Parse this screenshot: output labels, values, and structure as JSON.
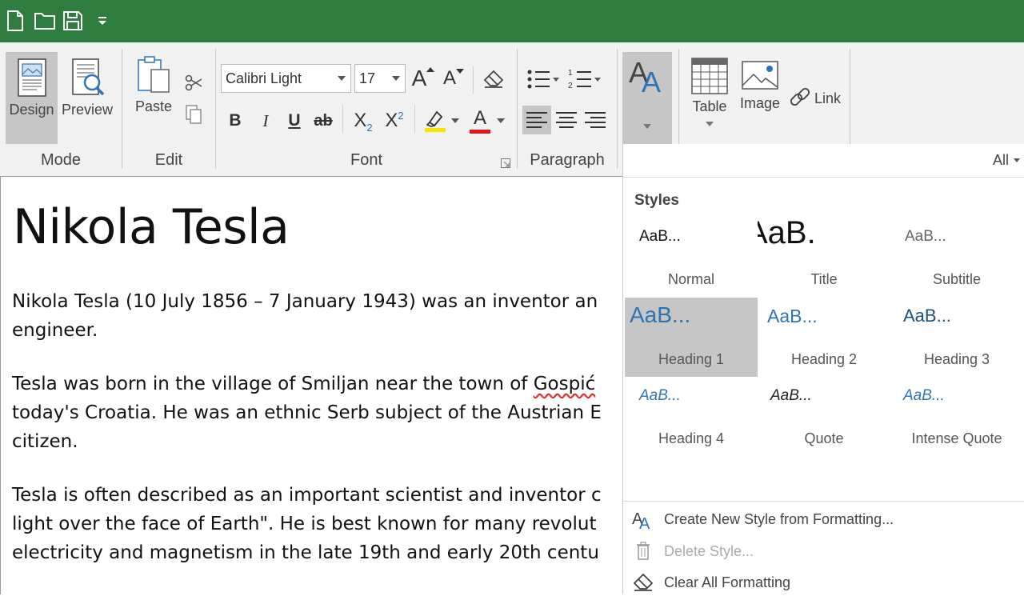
{
  "quick_access": {
    "icons": [
      "new-document-icon",
      "open-folder-icon",
      "save-icon",
      "customize-dropdown-icon"
    ]
  },
  "ribbon": {
    "mode": {
      "label": "Mode",
      "design": "Design",
      "preview": "Preview"
    },
    "edit": {
      "label": "Edit",
      "paste": "Paste"
    },
    "font": {
      "label": "Font",
      "family": "Calibri Light",
      "size": "17",
      "bold": "B",
      "italic": "I",
      "underline": "U",
      "strike": "ab",
      "subscript_base": "X",
      "subscript": "2",
      "superscript_base": "X",
      "superscript": "2",
      "grow": "A",
      "shrink": "A",
      "font_color_letter": "A",
      "font_color": "#e0161b",
      "highlight_color": "#f5e600"
    },
    "paragraph": {
      "label": "Paragraph"
    },
    "insert": {
      "table": "Table",
      "image": "Image",
      "link": "Link"
    }
  },
  "document": {
    "title": "Nikola Tesla",
    "paragraphs": [
      {
        "line1": "Nikola Tesla (10 July 1856 – 7 January 1943) was an inventor an",
        "line2": "engineer."
      },
      {
        "line1_pre": "Tesla was born in the village of Smiljan near the town of ",
        "line1_err": "Gospić",
        "line2": "today's Croatia. He was an ethnic Serb subject of the Austrian E",
        "line3": "citizen."
      },
      {
        "line1": "Tesla is often described as an important scientist and inventor c",
        "line2": "light over the face of Earth\". He is best known for many revolut",
        "line3": "electricity and magnetism in the late 19th and early 20th centu"
      }
    ]
  },
  "styles_panel": {
    "filter": "All",
    "title": "Styles",
    "styles": [
      {
        "name": "Normal",
        "preview": "AaB..."
      },
      {
        "name": "Title",
        "preview": "AaB."
      },
      {
        "name": "Subtitle",
        "preview": "AaB..."
      },
      {
        "name": "Heading 1",
        "preview": "AaB...",
        "selected": true
      },
      {
        "name": "Heading 2",
        "preview": "AaB..."
      },
      {
        "name": "Heading 3",
        "preview": "AaB..."
      },
      {
        "name": "Heading 4",
        "preview": "AaB..."
      },
      {
        "name": "Quote",
        "preview": "AaB..."
      },
      {
        "name": "Intense Quote",
        "preview": "AaB..."
      }
    ],
    "actions": {
      "create": "Create New Style from Formatting...",
      "delete": "Delete Style...",
      "clear": "Clear All Formatting"
    },
    "accent_color": "#2e74b5"
  }
}
